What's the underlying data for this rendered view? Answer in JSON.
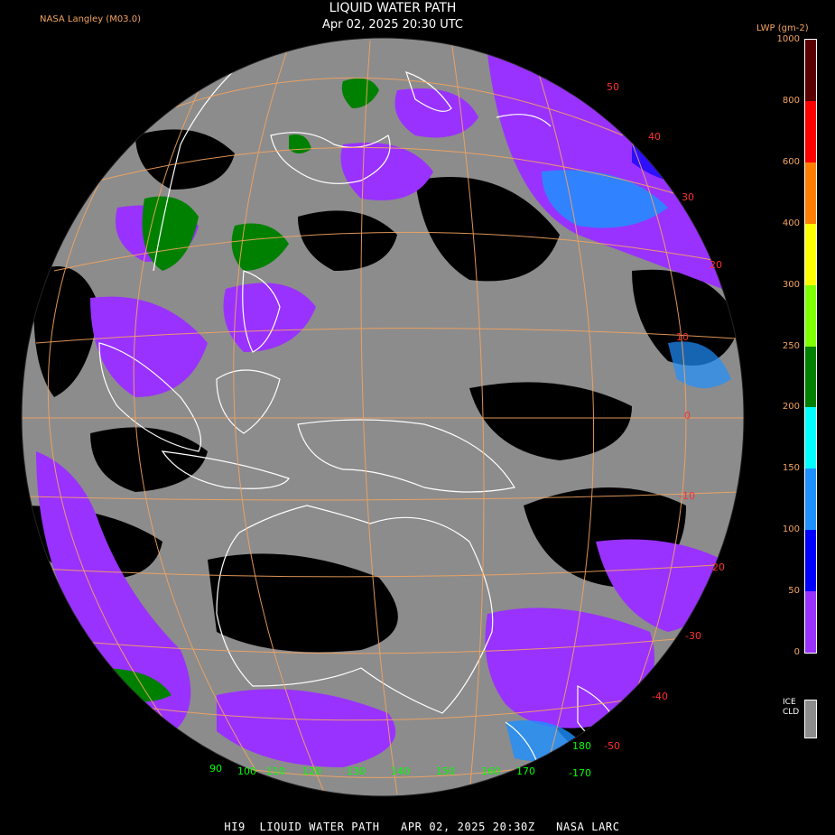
{
  "header": {
    "credit": "NASA Langley (M03.0)",
    "title": "LIQUID WATER PATH",
    "subtitle": "Apr 02, 2025 20:30 UTC"
  },
  "footer": {
    "caption": "HI9  LIQUID WATER PATH   APR 02, 2025 20:30Z   NASA LARC"
  },
  "legend": {
    "unit": "LWP (gm-2)",
    "ticks": [
      "1000",
      "800",
      "600",
      "400",
      "300",
      "250",
      "200",
      "150",
      "100",
      "50",
      "0"
    ],
    "colors": [
      "#5a0000",
      "#ff0000",
      "#ff8000",
      "#ffff00",
      "#80ff00",
      "#008000",
      "#00ffff",
      "#1e90ff",
      "#0000ff",
      "#9932ff"
    ],
    "ice_label_1": "ICE",
    "ice_label_2": "CLD",
    "ice_color": "#8c8c8c"
  },
  "map": {
    "lat_labels": [
      "50",
      "40",
      "30",
      "20",
      "10",
      "0",
      "-10",
      "-20",
      "-30",
      "-40",
      "-50"
    ],
    "lon_labels": [
      "90",
      "100",
      "110",
      "120",
      "130",
      "140",
      "150",
      "160",
      "170",
      "180",
      "-170"
    ],
    "grid_color": "#f4a460",
    "lat_label_color": "#ff3030",
    "lon_label_color": "#00ff00"
  }
}
